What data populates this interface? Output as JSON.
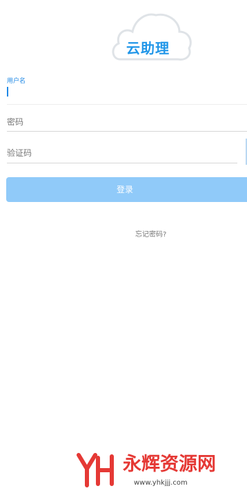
{
  "app": {
    "logo_text": "云助理"
  },
  "form": {
    "username": {
      "label": "用户名",
      "value": ""
    },
    "password": {
      "placeholder": "密码",
      "value": ""
    },
    "captcha": {
      "placeholder": "验证码",
      "value": ""
    },
    "submit_label": "登录",
    "forgot_label": "忘记密码?"
  },
  "watermark": {
    "title": "永辉资源网",
    "url": "www.yhkjjj.com"
  },
  "colors": {
    "accent": "#1e88e5",
    "button": "#90caf9",
    "watermark": "#e53935"
  },
  "icons": {
    "logo": "cloud-icon",
    "watermark_logo": "yh-monogram-icon"
  }
}
